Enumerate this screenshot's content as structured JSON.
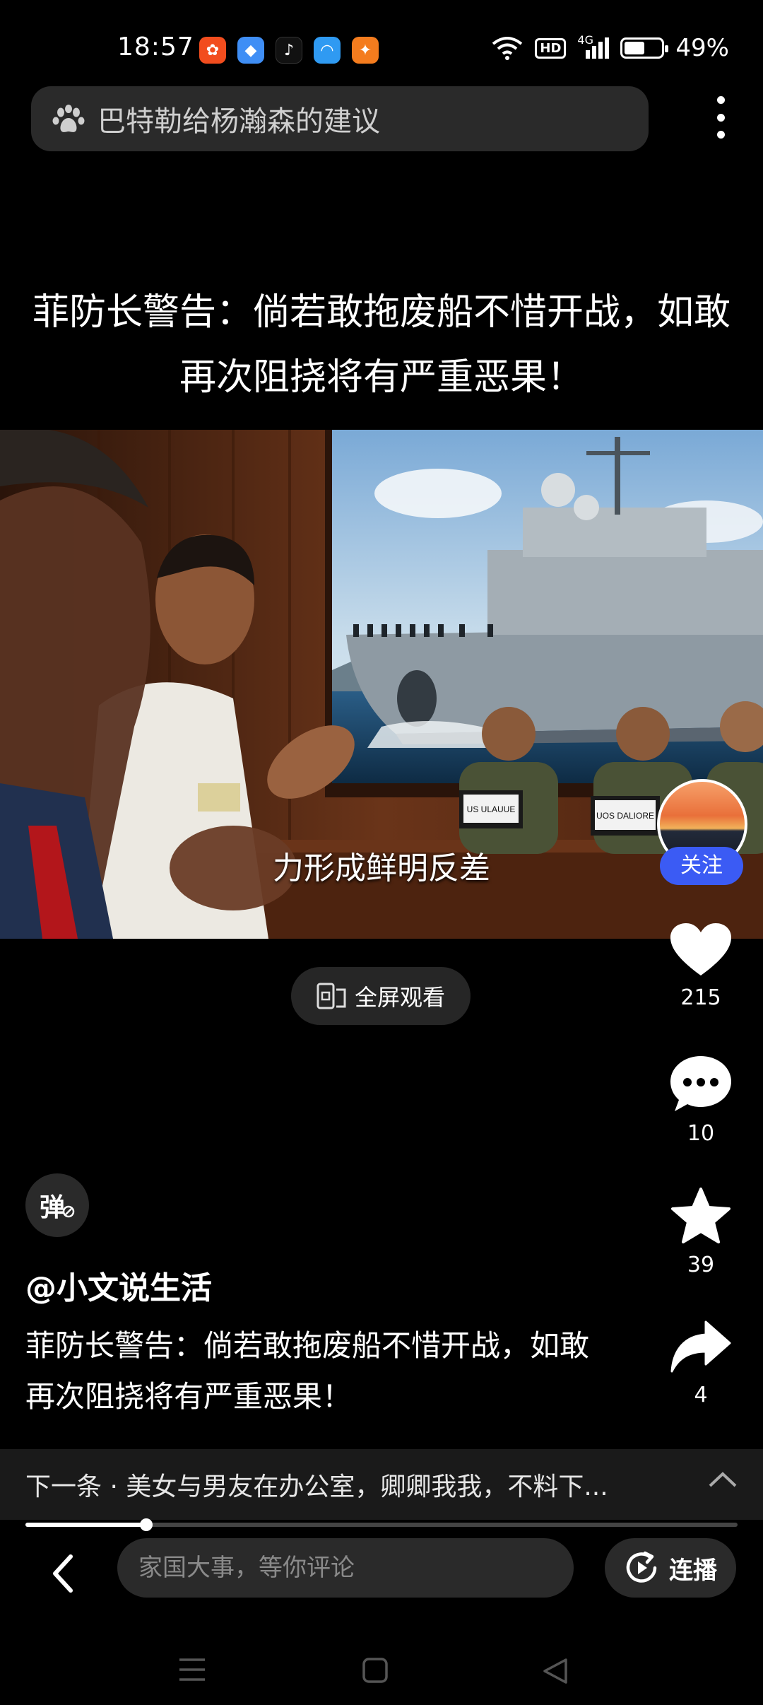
{
  "status_bar": {
    "time": "18:57",
    "network": "4G",
    "hd": "HD",
    "battery_percent_text": "49%",
    "battery_level": 0.49
  },
  "search": {
    "query": "巴特勒给杨瀚森的建议",
    "icon": "paw-icon"
  },
  "headline": "菲防长警告：倘若敢拖废船不惜开战，如敢再次阻挠将有严重恶果！",
  "video": {
    "subtitle": "力形成鲜明反差",
    "nameplate_1": "US ULAUUE",
    "nameplate_2": "UOS DALIORE"
  },
  "creator": {
    "follow_label": "关注",
    "handle": "@小文说生活"
  },
  "actions": {
    "likes": "215",
    "comments": "10",
    "favorites": "39",
    "shares": "4"
  },
  "fullscreen_label": "全屏观看",
  "danmu_label": "弹",
  "description": "菲防长警告：倘若敢拖废船不惜开战，如敢再次阻挠将有严重恶果！",
  "next_video": {
    "text": "下一条 · 美女与男友在办公室，卿卿我我，不料下..."
  },
  "playback": {
    "progress": 0.17
  },
  "comment_box": {
    "placeholder": "家国大事，等你评论"
  },
  "autoplay_label": "连播",
  "colors": {
    "accent": "#3b5bf4",
    "background": "#000000"
  }
}
